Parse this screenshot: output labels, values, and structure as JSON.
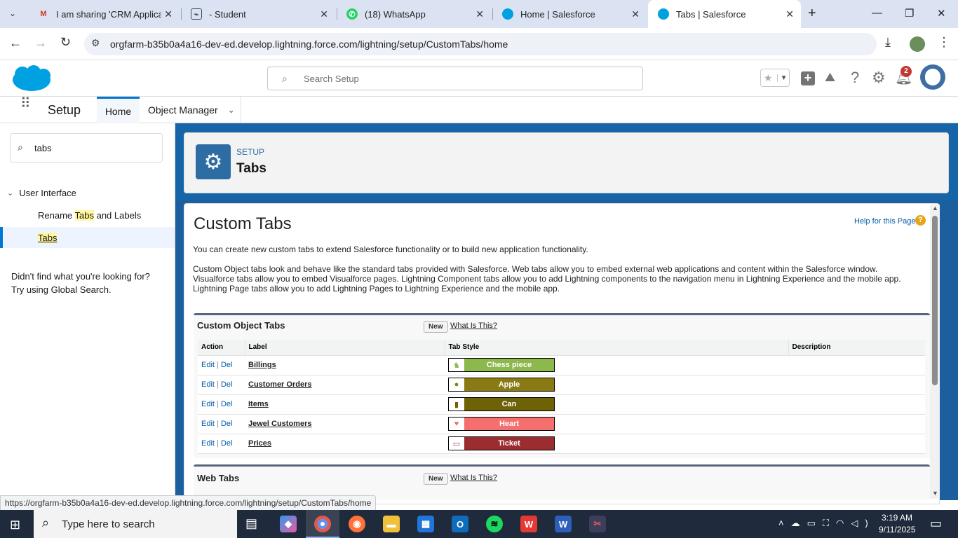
{
  "browser": {
    "tabs": [
      {
        "title": "I am sharing 'CRM Applicati",
        "icon": "gmail-icon",
        "color": "#d93025"
      },
      {
        "title": "- Student",
        "icon": "image-icon",
        "color": "#3c4a66"
      },
      {
        "title": "(18) WhatsApp",
        "icon": "whatsapp-icon",
        "color": "#25d366"
      },
      {
        "title": "Home | Salesforce",
        "icon": "salesforce-icon",
        "color": "#00a1e0"
      },
      {
        "title": "Tabs | Salesforce",
        "icon": "salesforce-icon",
        "color": "#00a1e0"
      }
    ],
    "url": "orgfarm-b35b0a4a16-dev-ed.develop.lightning.force.com/lightning/setup/CustomTabs/home",
    "status_url": "https://orgfarm-b35b0a4a16-dev-ed.develop.lightning.force.com/lightning/setup/CustomTabs/home"
  },
  "sf": {
    "search_placeholder": "Search Setup",
    "notification_count": "2",
    "app_name": "Setup",
    "nav": {
      "home": "Home",
      "object_manager": "Object Manager"
    }
  },
  "sidebar": {
    "quickfind_value": "tabs",
    "group": "User Interface",
    "item1": {
      "pre": "Rename ",
      "hl": "Tabs",
      "post": " and Labels"
    },
    "item2": "Tabs",
    "help1": "Didn't find what you're looking for?",
    "help2": "Try using Global Search."
  },
  "header": {
    "eyebrow": "SETUP",
    "title": "Tabs"
  },
  "content": {
    "title": "Custom Tabs",
    "help_link": "Help for this Page",
    "desc1": "You can create new custom tabs to extend Salesforce functionality or to build new application functionality.",
    "desc2a": "Custom Object tabs look and behave like the standard tabs provided with Salesforce. Web tabs allow you to embed external web applications and content within the Salesforce window.",
    "desc2b": "Visualforce tabs allow you to embed Visualforce pages. Lightning Component tabs allow you to add Lightning components to the navigation menu in Lightning Experience and the mobile app.",
    "desc2c": "Lightning Page tabs allow you to add Lightning Pages to Lightning Experience and the mobile app."
  },
  "custom_object_tabs": {
    "title": "Custom Object Tabs",
    "new_label": "New",
    "what_label": "What Is This?",
    "columns": [
      "Action",
      "Label",
      "Tab Style",
      "Description"
    ],
    "edit": "Edit",
    "del": "Del",
    "rows": [
      {
        "label": "Billings",
        "style": "Chess piece",
        "color": "#8db84c",
        "icon": "chess-piece-icon",
        "glyph": "♞"
      },
      {
        "label": "Customer Orders",
        "style": "Apple",
        "color": "#8a7a14",
        "icon": "apple-icon",
        "glyph": "●"
      },
      {
        "label": "Items",
        "style": "Can",
        "color": "#6e6207",
        "icon": "can-icon",
        "glyph": "▮"
      },
      {
        "label": "Jewel Customers",
        "style": "Heart",
        "color": "#f56f6f",
        "icon": "heart-icon",
        "glyph": "♥"
      },
      {
        "label": "Prices",
        "style": "Ticket",
        "color": "#9b2d30",
        "icon": "ticket-icon",
        "glyph": "▭"
      }
    ]
  },
  "web_tabs": {
    "title": "Web Tabs",
    "new_label": "New",
    "what_label": "What Is This?"
  },
  "taskbar": {
    "search_placeholder": "Type here to search",
    "time": "3:19 AM",
    "date": "9/11/2025"
  }
}
